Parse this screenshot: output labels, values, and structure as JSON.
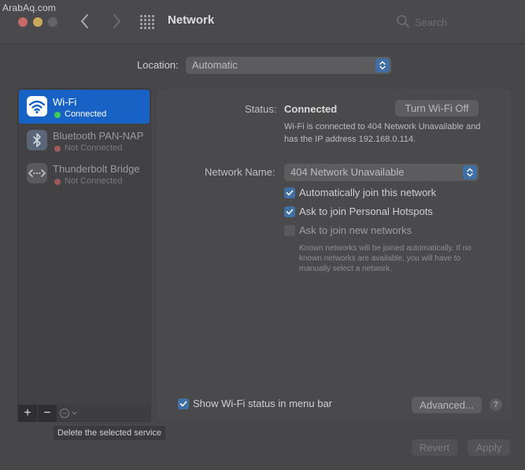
{
  "watermark": "ArabAq.com",
  "window": {
    "title": "Network"
  },
  "search": {
    "placeholder": "Search"
  },
  "location": {
    "label": "Location:",
    "value": "Automatic"
  },
  "services": [
    {
      "name": "Wi-Fi",
      "status": "Connected",
      "status_color": "#3ecf5a",
      "icon": "wifi-icon"
    },
    {
      "name": "Bluetooth PAN-NAP",
      "status": "Not Connected",
      "status_color": "#9c5a5a",
      "icon": "bluetooth-icon"
    },
    {
      "name": "Thunderbolt Bridge",
      "status": "Not Connected",
      "status_color": "#9c5a5a",
      "icon": "thunderbolt-bridge-icon"
    }
  ],
  "toolbar": {
    "add": "+",
    "remove": "−",
    "tooltip": "Delete the selected service"
  },
  "detail": {
    "status_label": "Status:",
    "status_value": "Connected",
    "wifi_off_button": "Turn Wi-Fi Off",
    "status_description": "Wi-Fi is connected to 404 Network Unavailable and has the IP address 192.168.0.114.",
    "network_name_label": "Network Name:",
    "network_name_value": "404 Network Unavailable",
    "options": [
      {
        "label": "Automatically join this network",
        "checked": true
      },
      {
        "label": "Ask to join Personal Hotspots",
        "checked": true
      },
      {
        "label": "Ask to join new networks",
        "checked": false
      }
    ],
    "known_networks_note": "Known networks will be joined automatically. If no known networks are available, you will have to manually select a network.",
    "show_status_label": "Show Wi-Fi status in menu bar",
    "show_status_checked": true,
    "advanced_button": "Advanced...",
    "help_button": "?"
  },
  "footer": {
    "revert": "Revert",
    "apply": "Apply"
  },
  "colors": {
    "accent": "#1762c4",
    "checkbox": "#3f6fa3",
    "window_bg": "#474749"
  }
}
